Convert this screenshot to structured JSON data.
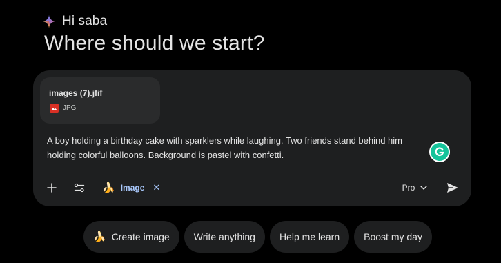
{
  "greeting": {
    "text": "Hi saba",
    "headline": "Where should we start?"
  },
  "prompt": {
    "attachment": {
      "file_name": "images (7).jfif",
      "file_type": "JPG",
      "icon": "image-file-icon"
    },
    "text": "A boy holding a birthday cake with sparklers while laughing. Two friends stand behind him holding colorful balloons. Background is pastel with confetti.",
    "toolbar": {
      "add_icon": "plus-icon",
      "tools_icon": "tune-icon",
      "image_chip": {
        "emoji": "🍌",
        "label": "Image",
        "close": "✕"
      },
      "model": {
        "label": "Pro",
        "icon": "chevron-down-icon"
      },
      "send_icon": "send-icon"
    }
  },
  "suggestions": [
    {
      "emoji": "🍌",
      "label": "Create image"
    },
    {
      "label": "Write anything"
    },
    {
      "label": "Help me learn"
    },
    {
      "label": "Boost my day"
    }
  ],
  "colors": {
    "background": "#000000",
    "surface": "#1e1f20",
    "card": "#2a2b2c",
    "accent_blue": "#a8c7fa",
    "grammarly": "#15c39a",
    "file_icon_red": "#d93025"
  }
}
